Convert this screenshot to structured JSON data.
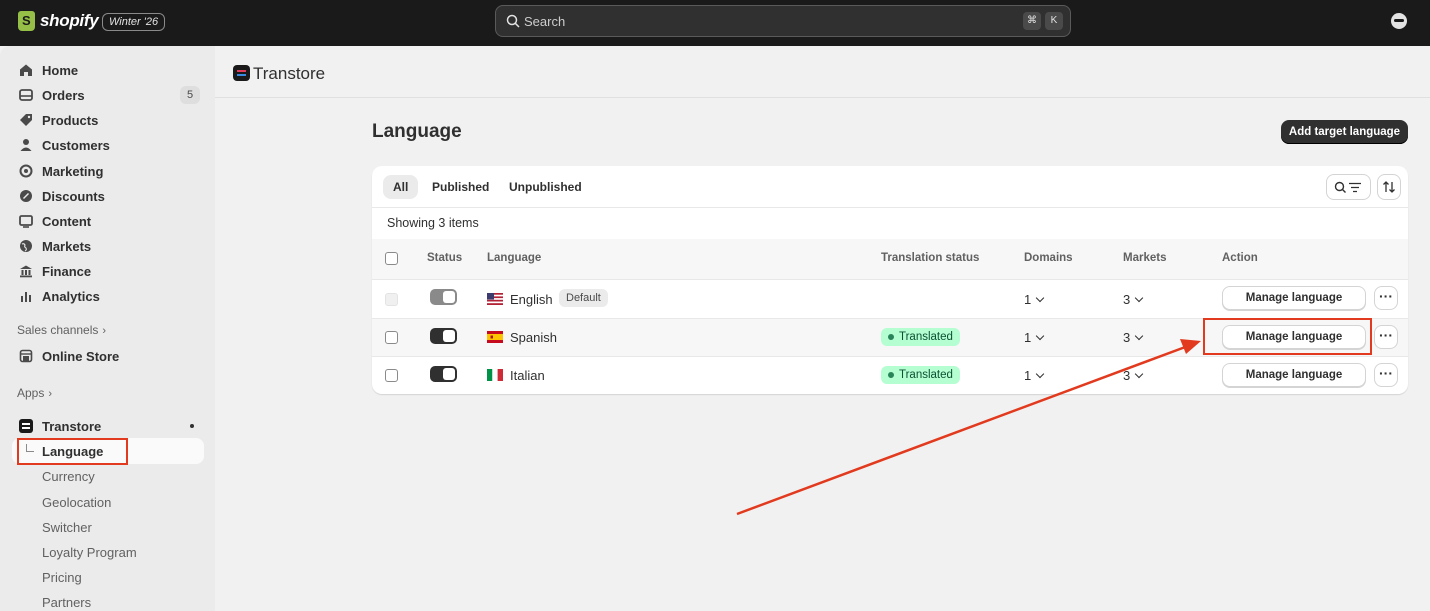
{
  "topbar": {
    "brand": "shopify",
    "edition": "Winter '26",
    "search_placeholder": "Search",
    "shortcut_keys": [
      "⌘",
      "K"
    ]
  },
  "sidebar": {
    "items": [
      {
        "label": "Home",
        "icon": "home-icon"
      },
      {
        "label": "Orders",
        "icon": "orders-icon",
        "badge": "5"
      },
      {
        "label": "Products",
        "icon": "tag-icon"
      },
      {
        "label": "Customers",
        "icon": "person-icon"
      },
      {
        "label": "Marketing",
        "icon": "target-icon"
      },
      {
        "label": "Discounts",
        "icon": "discount-icon"
      },
      {
        "label": "Content",
        "icon": "content-icon"
      },
      {
        "label": "Markets",
        "icon": "globe-icon"
      },
      {
        "label": "Finance",
        "icon": "bank-icon"
      },
      {
        "label": "Analytics",
        "icon": "chart-icon"
      }
    ],
    "sales_channels_label": "Sales channels",
    "online_store": "Online Store",
    "apps_label": "Apps",
    "app_name": "Transtore",
    "app_subitems": [
      "Language",
      "Currency",
      "Geolocation",
      "Switcher",
      "Loyalty Program",
      "Pricing",
      "Partners"
    ]
  },
  "app_header": {
    "title": "Transtore"
  },
  "page": {
    "title": "Language",
    "primary_action": "Add target language",
    "tabs": [
      "All",
      "Published",
      "Unpublished"
    ],
    "showing": "Showing 3 items",
    "columns": [
      "Status",
      "Language",
      "Translation status",
      "Domains",
      "Markets",
      "Action"
    ],
    "rows": [
      {
        "language": "English",
        "badge": "Default",
        "translation_status": "",
        "domains": "1",
        "markets": "3",
        "action": "Manage language",
        "published": true,
        "flag": "us-flag"
      },
      {
        "language": "Spanish",
        "badge": "",
        "translation_status": "Translated",
        "domains": "1",
        "markets": "3",
        "action": "Manage language",
        "published": true,
        "flag": "es-flag"
      },
      {
        "language": "Italian",
        "badge": "",
        "translation_status": "Translated",
        "domains": "1",
        "markets": "3",
        "action": "Manage language",
        "published": true,
        "flag": "it-flag"
      }
    ],
    "more_label": "···"
  },
  "colors": {
    "topbar": "#1a1a1a",
    "annotation_red": "#e23a1e",
    "success_badge": "#b4fed2"
  }
}
